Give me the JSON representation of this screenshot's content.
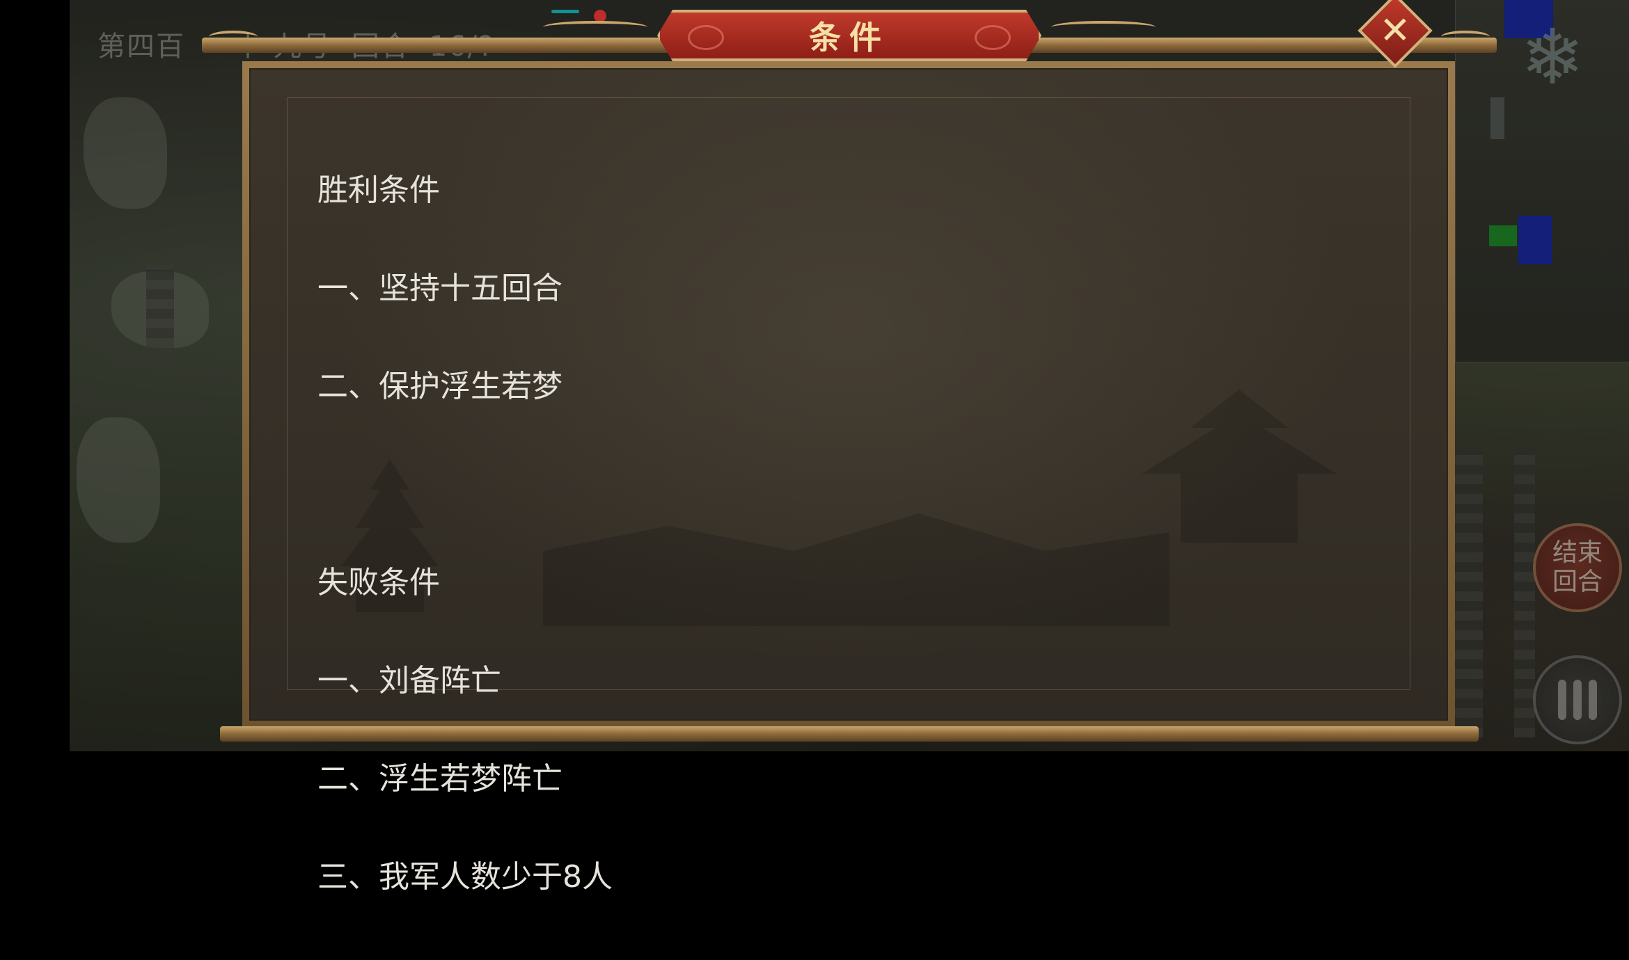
{
  "hud": {
    "round_chapter": "第四百",
    "round_mid": "一十·九号",
    "round_label": "回合",
    "round_count": "16/?"
  },
  "buttons": {
    "end_turn_line1": "结束",
    "end_turn_line2": "回合"
  },
  "dialog": {
    "title": "条件",
    "close_symbol": "✕",
    "victory_heading": "胜利条件",
    "victory_items": [
      "一、坚持十五回合",
      "二、保护浮生若梦"
    ],
    "defeat_heading": "失败条件",
    "defeat_items": [
      "一、刘备阵亡",
      "二、浮生若梦阵亡",
      "三、我军人数少于8人"
    ]
  },
  "icons": {
    "snow": "snowflake-icon",
    "menu": "menu-bars-icon",
    "close": "close-icon"
  },
  "colors": {
    "banner_red": "#c0392b",
    "gold_trim": "#caa66d",
    "panel_bg": "#372f27",
    "text": "#e6e3dc"
  }
}
